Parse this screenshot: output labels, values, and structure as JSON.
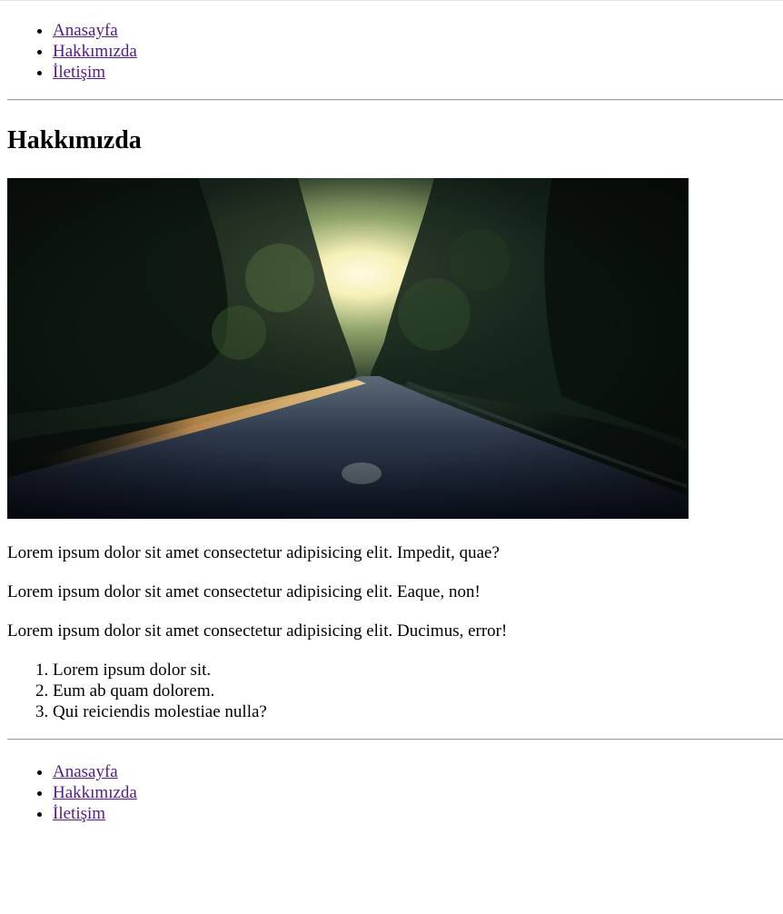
{
  "header_nav": {
    "items": [
      {
        "label": "Anasayfa"
      },
      {
        "label": "Hakkımızda"
      },
      {
        "label": "İletişim"
      }
    ]
  },
  "main": {
    "title": "Hakkımızda",
    "paragraphs": [
      "Lorem ipsum dolor sit amet consectetur adipisicing elit. Impedit, quae?",
      "Lorem ipsum dolor sit amet consectetur adipisicing elit. Eaque, non!",
      "Lorem ipsum dolor sit amet consectetur adipisicing elit. Ducimus, error!"
    ],
    "ordered_list": [
      "Lorem ipsum dolor sit.",
      "Eum ab quam dolorem.",
      "Qui reiciendis molestiae nulla?"
    ]
  },
  "footer_nav": {
    "items": [
      {
        "label": "Anasayfa"
      },
      {
        "label": "Hakkımızda"
      },
      {
        "label": "İletişim"
      }
    ]
  },
  "colors": {
    "link_visited": "#551a8b",
    "text": "#000000",
    "background": "#ffffff"
  }
}
